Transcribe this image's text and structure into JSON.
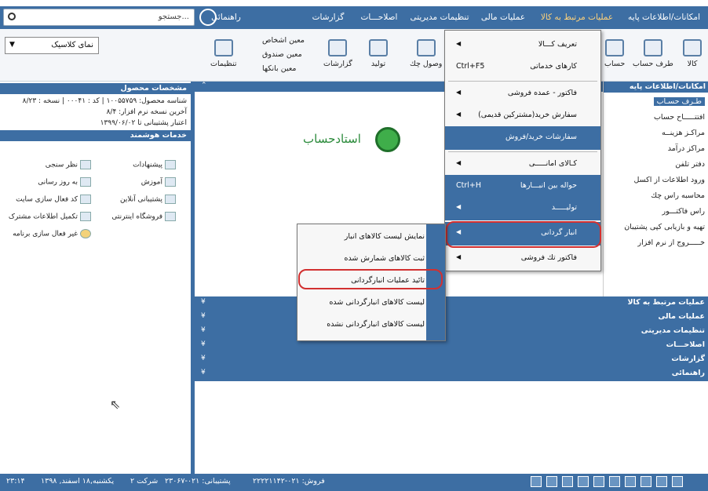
{
  "menubar": {
    "items": [
      "امکانات/اطلاعات پایه",
      "عملیات مرتبط به کالا",
      "عملیات مالی",
      "تنظیمات مدیریتی",
      "اصلاحـــات",
      "گزارشات",
      "راهنمائی"
    ],
    "active_index": 1,
    "search_placeholder": "جستجو..."
  },
  "toolbar": {
    "style_select": "نمای کلاسیک",
    "buttons": [
      {
        "label": "کالا",
        "icon": "cube-icon"
      },
      {
        "label": "طرف حساب",
        "icon": "contact-icon"
      },
      {
        "label": "حساب",
        "icon": "account-icon"
      },
      {
        "label": "وصول چك",
        "icon": "check-receive-icon"
      },
      {
        "label": "تولید",
        "icon": "factory-icon"
      },
      {
        "label": "گزارشات",
        "icon": "chart-icon"
      },
      {
        "label": "تنظیمات",
        "icon": "gear-icon"
      }
    ],
    "helpers": [
      "معین اشخاص",
      "معین صندوق",
      "معین بانکها"
    ]
  },
  "left_panel": {
    "product_title": "مشخصات محصول",
    "product_lines": [
      "شناسه محصول: ۱۰۰۵۵۷۵۹ | کد : ۰۰۰۴۱ | نسخه : ۸/۲۳",
      "آخرین نسخه نرم افزار: ۸/۴",
      "اعتبار پشتیبانی تا ۱۳۹۹/۰۶/۰۲"
    ],
    "services_title": "خدمات هوشمند",
    "services": [
      "پیشنهادات",
      "نظر سنجی",
      "آموزش",
      "به روز رسانی",
      "پشتیبانی آنلاین",
      "کد فعال سازی سایت",
      "فروشگاه اینترنتی",
      "تکمیل اطلاعات مشترک",
      "غیر فعال سازی برنامه"
    ]
  },
  "logo_text": "استادحساب",
  "right_panel": {
    "title": "امکانات/اطلاعات پایه",
    "items": [
      "طـرف حسـاب",
      "افتتـــــاح حساب",
      "مراکـز هزینــه",
      "مراکز درآمد",
      "دفتر تلفن",
      "ورود اطلاعات از اکسل",
      "محاسبه راس چك",
      "راس فاكتـــور",
      "تهیه و بازیابی کپی پشتیبان",
      "خـــــروج از نرم افزار"
    ],
    "selected_index": 0
  },
  "bottom_sections": [
    "عملیات مرتبط به کالا",
    "عملیات مالی",
    "تنظیمات مدیریتی",
    "اصلاحـــات",
    "گزارشات",
    "راهنمائی"
  ],
  "main_menu": {
    "items": [
      {
        "label": "تعریف کـــالا",
        "shortcut": ""
      },
      {
        "label": "کارهای خدماتی",
        "shortcut": "Ctrl+F5"
      },
      {
        "label": "فاكتور - عمده فروشی",
        "shortcut": ""
      },
      {
        "label": "سفارش خرید(مشترکین قدیمی)",
        "shortcut": ""
      },
      {
        "label": "سفارشات خرید/فروش",
        "shortcut": ""
      },
      {
        "label": "کـالای امانـــــی",
        "shortcut": ""
      },
      {
        "label": "حواله بین انبـــارها",
        "shortcut": "Ctrl+H"
      },
      {
        "label": "تولیـــــد",
        "shortcut": ""
      },
      {
        "label": "انبار گردانی",
        "shortcut": ""
      },
      {
        "label": "فاکتور تك فروشی",
        "shortcut": ""
      }
    ]
  },
  "sub_menu": {
    "items": [
      "نمایش لیست کالاهای انبار",
      "ثبت کالاهای شمارش شده",
      "تائید عملیات انبارگردانی",
      "لیست کالاهای انبارگردانی شده",
      "لیست کالاهای انبارگردانی نشده"
    ]
  },
  "status": {
    "time": "۲۳:۱۴",
    "date": "یکشنبه,۱۸ اسفند, ۱۳۹۸",
    "company": "شرکت ۲",
    "support": "پشتیبانی: ۰۲۱-۲۳۰۶۷",
    "sales": "فروش: ۰۲۱-۲۲۲۲۱۱۴۲"
  },
  "colors": {
    "accent": "#3d6ea3",
    "highlight": "#d23030"
  }
}
